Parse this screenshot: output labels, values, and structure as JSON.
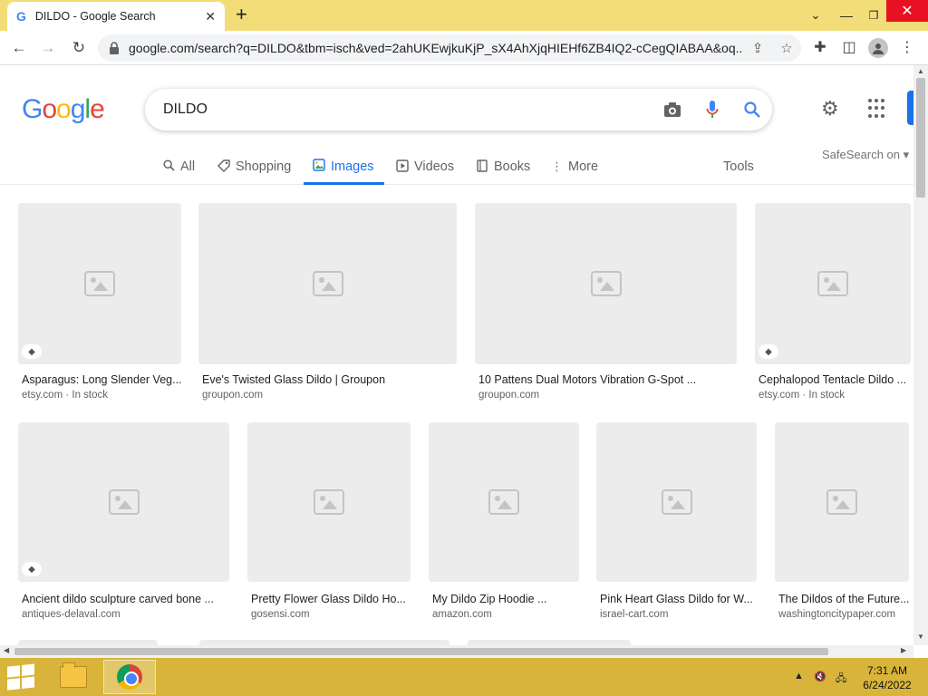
{
  "browser": {
    "tab_title": "DILDO - Google Search",
    "tab_favicon": "G",
    "url": "google.com/search?q=DILDO&tbm=isch&ved=2ahUKEwjkuKjP_sX4AhXjqHIEHf6ZB4IQ2-cCegQIABAA&oq..."
  },
  "search": {
    "logo": [
      "G",
      "o",
      "o",
      "g",
      "l",
      "e"
    ],
    "logo_colors": [
      "#4285f4",
      "#ea4335",
      "#fbbc05",
      "#4285f4",
      "#34a853",
      "#ea4335"
    ],
    "query": "DILDO"
  },
  "nav": {
    "tabs": [
      {
        "label": "All",
        "icon": "search-icon"
      },
      {
        "label": "Shopping",
        "icon": "tag-icon"
      },
      {
        "label": "Images",
        "icon": "image-icon",
        "active": true
      },
      {
        "label": "Videos",
        "icon": "play-icon"
      },
      {
        "label": "Books",
        "icon": "book-icon"
      },
      {
        "label": "More",
        "icon": "more-vert-icon"
      }
    ],
    "tools": "Tools",
    "safesearch": "SafeSearch on"
  },
  "results": [
    {
      "title": "Asparagus: Long Slender Veg...",
      "source": "etsy.com · In stock",
      "tag": true
    },
    {
      "title": "Eve's Twisted Glass Dildo | Groupon",
      "source": "groupon.com",
      "tag": false
    },
    {
      "title": "10 Pattens Dual Motors Vibration G-Spot ...",
      "source": "groupon.com",
      "tag": false
    },
    {
      "title": "Cephalopod Tentacle Dildo ...",
      "source": "etsy.com · In stock",
      "tag": true
    },
    {
      "title": "Ancient dildo sculpture carved bone ...",
      "source": "antiques-delaval.com",
      "tag": true
    },
    {
      "title": "Pretty Flower Glass Dildo Ho...",
      "source": "gosensi.com",
      "tag": false
    },
    {
      "title": "My Dildo Zip Hoodie ...",
      "source": "amazon.com",
      "tag": false
    },
    {
      "title": "Pink Heart Glass Dildo for W...",
      "source": "israel-cart.com",
      "tag": false
    },
    {
      "title": "The Dildos of the Future...",
      "source": "washingtoncitypaper.com",
      "tag": false
    }
  ],
  "taskbar": {
    "time": "7:31 AM",
    "date": "6/24/2022"
  }
}
